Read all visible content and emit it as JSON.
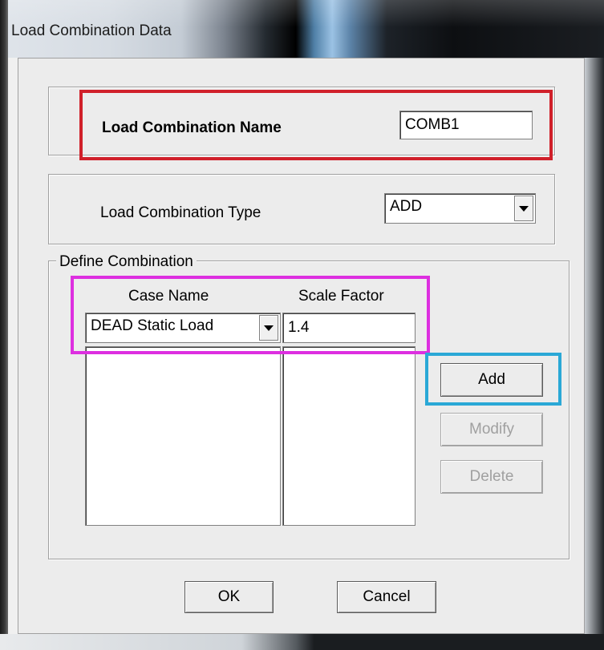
{
  "window": {
    "title": "Load Combination Data"
  },
  "name_group": {
    "label": "Load Combination Name",
    "value": "COMB1"
  },
  "type_group": {
    "label": "Load Combination Type",
    "selected": "ADD"
  },
  "define_group": {
    "title": "Define Combination",
    "col_case_name": "Case Name",
    "col_scale_factor": "Scale Factor",
    "case_selected": "DEAD Static Load",
    "scale_value": "1.4",
    "rows": []
  },
  "buttons": {
    "add": "Add",
    "modify": "Modify",
    "delete": "Delete",
    "ok": "OK",
    "cancel": "Cancel"
  },
  "highlights": {
    "name_color": "#d0202a",
    "input_color": "#dd2fe0",
    "add_color": "#2aa8d6"
  },
  "icons": {
    "dropdown": "chevron-down-icon"
  }
}
